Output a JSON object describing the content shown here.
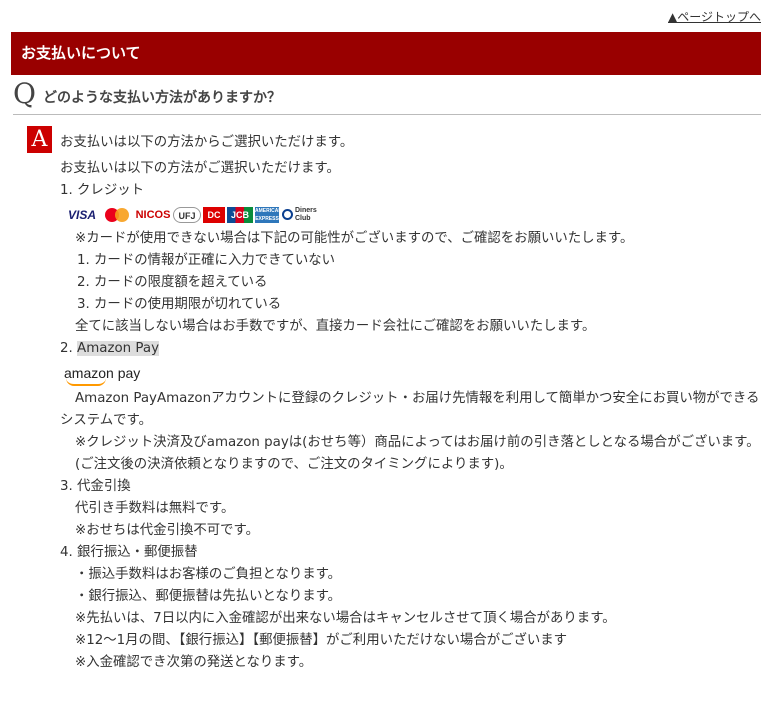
{
  "top_link": "▲ページトップへ",
  "header_title": "お支払いについて",
  "question": {
    "mark": "Q",
    "text": "どのような支払い方法がありますか？"
  },
  "answer": {
    "mark": "A",
    "intro": "お支払いは以下の方法からご選択いただけます。",
    "intro2": "お支払いは以下の方法がご選択いただけます。",
    "credit": {
      "heading": "1. クレジット",
      "card_brands": [
        "VISA",
        "MasterCard",
        "NICOS",
        "UFJ Card",
        "DC",
        "JCB",
        "AMERICAN EXPRESS",
        "Diners Club International"
      ],
      "note": "※カードが使用できない場合は下記の可能性がございますので、ご確認をお願いいたします。",
      "reasons": [
        "1. カードの情報が正確に入力できていない",
        "2. カードの限度額を超えている",
        "3. カードの使用期限が切れている"
      ],
      "footer": "全てに該当しない場合はお手数ですが、直接カード会社にご確認をお願いいたします。"
    },
    "amazon": {
      "heading_num": "2. ",
      "heading_label": "Amazon Pay",
      "logo_text": "amazon pay",
      "desc": "Amazon PayAmazonアカウントに登録のクレジット・お届け先情報を利用して簡単かつ安全にお買い物ができるシステムです。",
      "note": "※クレジット決済及びamazon payは(おせち等）商品によってはお届け前の引き落としとなる場合がございます。",
      "note2": "(ご注文後の決済依頼となりますので、ご注文のタイミングによります)。"
    },
    "cod": {
      "heading": "3. 代金引換",
      "lines": [
        "代引き手数料は無料です。",
        "※おせちは代金引換不可です。"
      ]
    },
    "bank": {
      "heading": "4. 銀行振込・郵便振替",
      "lines": [
        "・振込手数料はお客様のご負担となります。",
        "・銀行振込、郵便振替は先払いとなります。",
        "※先払いは、7日以内に入金確認が出来ない場合はキャンセルさせて頂く場合があります。",
        "※12～1月の間、【銀行振込】【郵便振替】がご利用いただけない場合がございます",
        "※入金確認でき次第の発送となります。"
      ]
    }
  },
  "colors": {
    "header_bg": "#990000",
    "a_mark_bg": "#cc0000"
  }
}
